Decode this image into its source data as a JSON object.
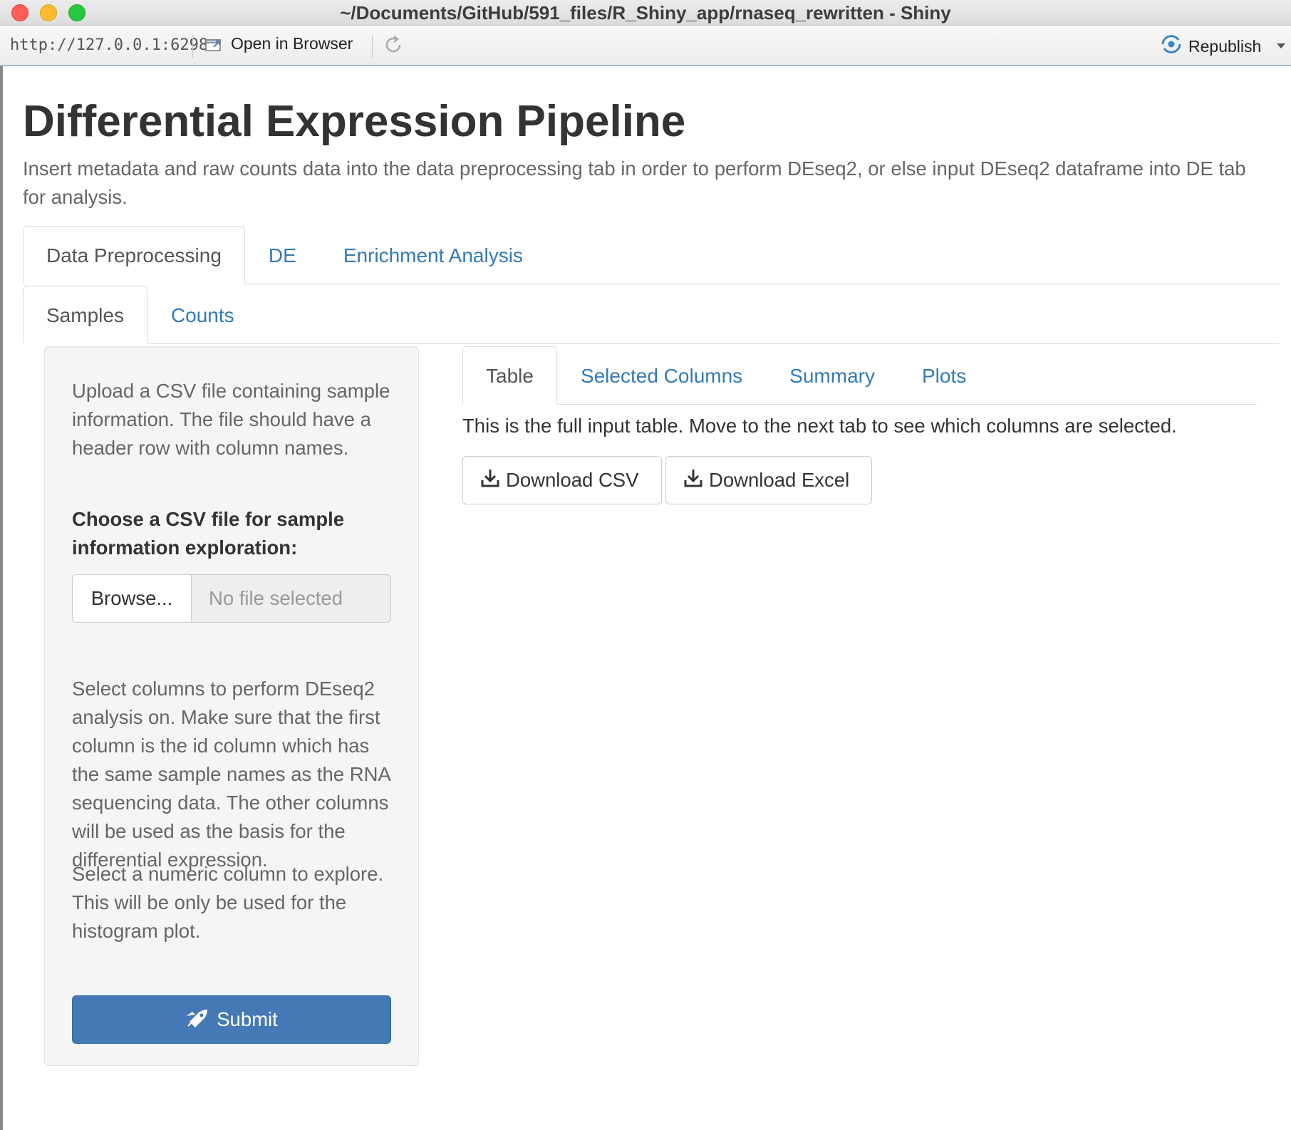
{
  "window": {
    "title": "~/Documents/GitHub/591_files/R_Shiny_app/rnaseq_rewritten - Shiny"
  },
  "toolbar": {
    "url": "http://127.0.0.1:6298",
    "open_in_browser": "Open in Browser",
    "republish": "Republish"
  },
  "app": {
    "title": "Differential Expression Pipeline",
    "description": "Insert metadata and raw counts data into the data preprocessing tab in order to perform DEseq2, or else input DEseq2 dataframe into DE tab for analysis."
  },
  "tabs": {
    "main": [
      "Data Preprocessing",
      "DE",
      "Enrichment Analysis"
    ],
    "sub": [
      "Samples",
      "Counts"
    ],
    "inner": [
      "Table",
      "Selected Columns",
      "Summary",
      "Plots"
    ]
  },
  "sidebar": {
    "upload_help": "Upload a CSV file containing sample information. The file should have a header row with column names.",
    "file_label": "Choose a CSV file for sample information exploration:",
    "browse_label": "Browse...",
    "file_placeholder": "No file selected",
    "columns_help": "Select columns to perform DEseq2 analysis on. Make sure that the first column is the id column which has the same sample names as the RNA sequencing data. The other columns will be used as the basis for the differential expression.",
    "numeric_help": "Select a numeric column to explore. This will be only be used for the histogram plot.",
    "submit_label": "Submit"
  },
  "main": {
    "table_note": "This is the full input table. Move to the next tab to see which columns are selected.",
    "download_csv": "Download CSV",
    "download_excel": "Download Excel"
  },
  "colors": {
    "link": "#337ab7",
    "primary_button": "#4479b5",
    "well_bg": "#f5f5f5",
    "muted_text": "#666666"
  },
  "icons": {
    "open_in_browser": "browser-window-icon",
    "refresh": "refresh-icon",
    "republish": "republish-icon",
    "download": "download-icon",
    "submit": "rocket-icon"
  }
}
